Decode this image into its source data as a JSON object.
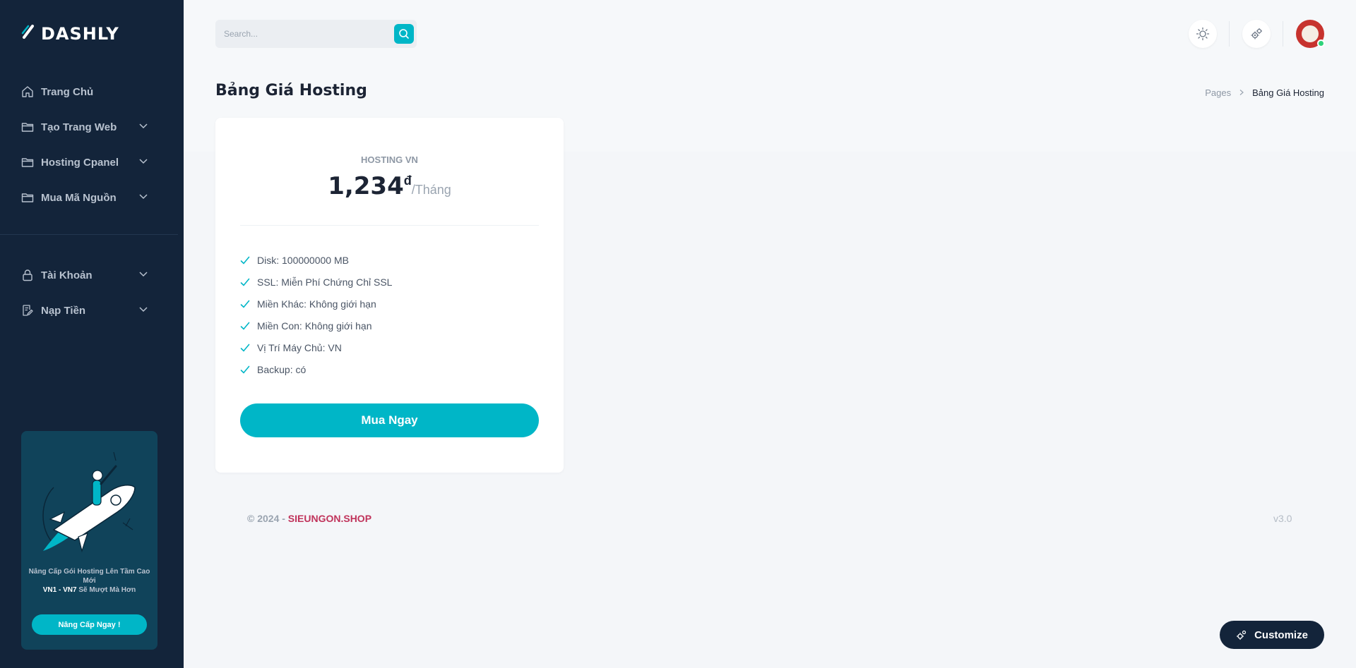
{
  "brand": {
    "name": "DASHLY",
    "logo_icon": "slash-logo-icon"
  },
  "sidebar": {
    "items": [
      {
        "label": "Trang Chủ",
        "icon": "home-icon",
        "has_submenu": false
      },
      {
        "label": "Tạo Trang Web",
        "icon": "folder-icon",
        "has_submenu": true
      },
      {
        "label": "Hosting Cpanel",
        "icon": "folder-icon",
        "has_submenu": true
      },
      {
        "label": "Mua Mã Nguồn",
        "icon": "folder-icon",
        "has_submenu": true
      },
      {
        "label": "Tài Khoản",
        "icon": "lock-icon",
        "has_submenu": true
      },
      {
        "label": "Nạp Tiền",
        "icon": "edit-note-icon",
        "has_submenu": true
      }
    ],
    "promo": {
      "line1": "Nâng Cấp Gói Hosting Lên Tầm Cao Mới",
      "highlight": "VN1 - VN7",
      "line2": " Sẽ Mượt Mà Hơn",
      "button_label": "Nâng Cấp Ngay !"
    }
  },
  "header": {
    "search_placeholder": "Search...",
    "search_value": "",
    "icons": [
      "sun-icon",
      "gears-icon",
      "avatar"
    ],
    "user_status": "online"
  },
  "page": {
    "title": "Bảng Giá Hosting",
    "breadcrumb": [
      "Pages",
      "Bảng Giá Hosting"
    ]
  },
  "plan": {
    "name": "HOSTING VN",
    "price": "1,234",
    "currency": "đ",
    "period": "/Tháng",
    "features": [
      "Disk: 100000000 MB",
      "SSL: Miễn Phí Chứng Chỉ SSL",
      "Miền Khác: Không giới hạn",
      "Miền Con: Không giới hạn",
      "Vị Trí Máy Chủ: VN",
      "Backup: có"
    ],
    "button_label": "Mua Ngay"
  },
  "footer": {
    "copyright": "© 2024 - ",
    "site": "SIEUNGON.SHOP",
    "version": "v3.0"
  },
  "customize_label": "Customize",
  "colors": {
    "sidebar_bg": "#13243a",
    "accent": "#00b6c7",
    "brand_link": "#c0335b",
    "status_online": "#2fd37a"
  }
}
